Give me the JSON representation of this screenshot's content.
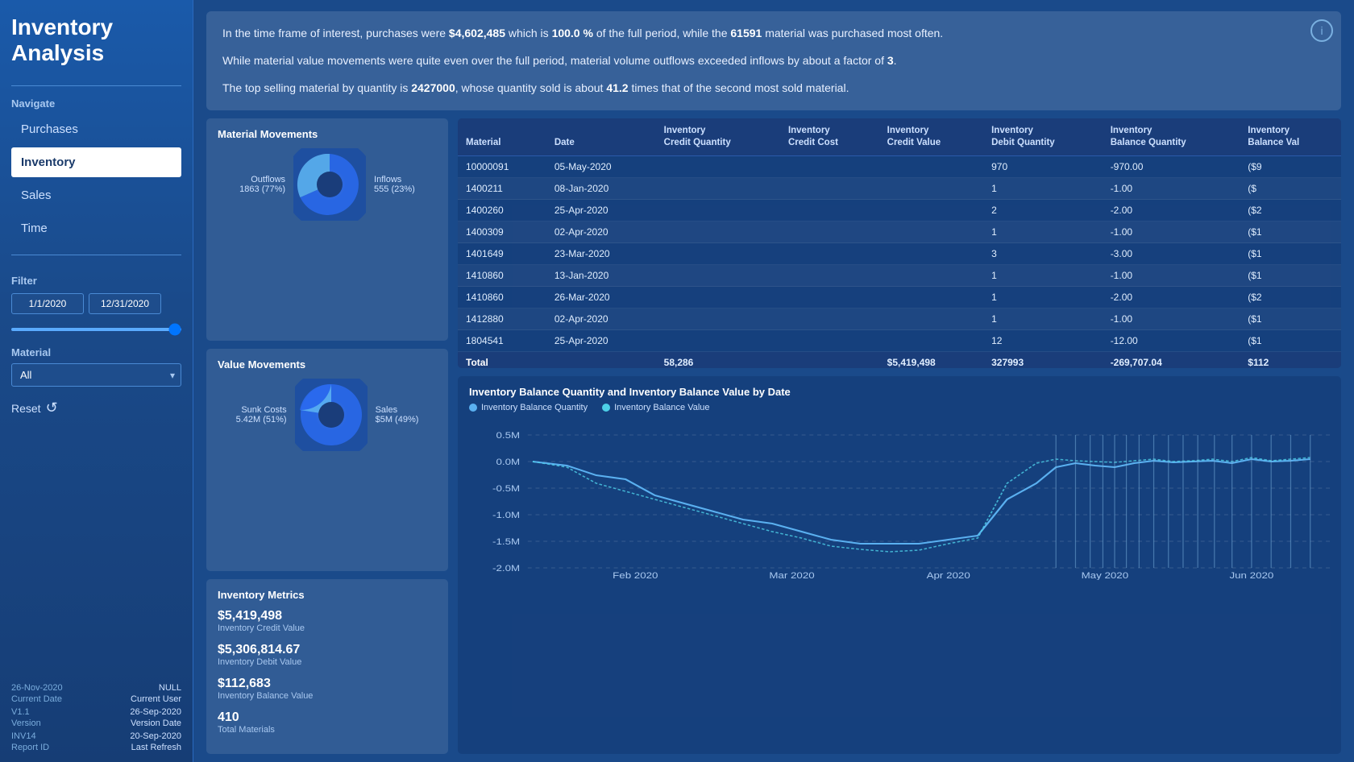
{
  "sidebar": {
    "title": "Inventory\nAnalysis",
    "navigate_label": "Navigate",
    "nav_items": [
      {
        "label": "Purchases",
        "active": false
      },
      {
        "label": "Inventory",
        "active": true
      },
      {
        "label": "Sales",
        "active": false
      },
      {
        "label": "Time",
        "active": false
      }
    ],
    "filter_label": "Filter",
    "date_start": "1/1/2020",
    "date_end": "12/31/2020",
    "material_label": "Material",
    "material_value": "All",
    "reset_label": "Reset",
    "footer": [
      {
        "key": "26-Nov-2020",
        "val": "NULL",
        "key_label": "Current Date",
        "val_label": "Current User"
      },
      {
        "key": "V1.1",
        "val": "26-Sep-2020",
        "key_label": "Version",
        "val_label": "Version Date"
      },
      {
        "key": "INV14",
        "val": "20-Sep-2020",
        "key_label": "Report ID",
        "val_label": "Last Refresh"
      }
    ]
  },
  "insight": {
    "line1_pre": "In the time frame of interest, purchases were ",
    "line1_amount": "$4,602,485",
    "line1_mid": " which is ",
    "line1_pct": "100.0 %",
    "line1_post": " of the full period, while the ",
    "line1_material": "61591",
    "line1_end": " material was purchased most often.",
    "line2": "While material value movements were quite even over the full period, material volume outflows exceeded inflows by about a factor of ",
    "line2_bold": "3",
    "line2_end": ".",
    "line3_pre": "The top selling material by quantity is ",
    "line3_material": "2427000",
    "line3_mid": ", whose quantity sold is about ",
    "line3_times": "41.2",
    "line3_end": " times that of the second most sold material."
  },
  "material_movements": {
    "title": "Material Movements",
    "outflows_label": "Outflows",
    "outflows_val": "1863 (77%)",
    "inflows_label": "Inflows",
    "inflows_val": "555 (23%)",
    "outflows_pct": 77,
    "inflows_pct": 23
  },
  "value_movements": {
    "title": "Value Movements",
    "sunk_label": "Sunk Costs",
    "sunk_val": "5.42M (51%)",
    "sales_label": "Sales",
    "sales_val": "$5M (49%)",
    "sunk_pct": 51,
    "sales_pct": 49
  },
  "metrics": {
    "title": "Inventory Metrics",
    "items": [
      {
        "value": "$5,419,498",
        "label": "Inventory Credit Value"
      },
      {
        "value": "$5,306,814.67",
        "label": "Inventory Debit Value"
      },
      {
        "value": "$112,683",
        "label": "Inventory Balance Value"
      },
      {
        "value": "410",
        "label": "Total Materials"
      }
    ]
  },
  "table": {
    "columns": [
      "Material",
      "Date",
      "Inventory\nCredit Quantity",
      "Inventory\nCredit Cost",
      "Inventory\nCredit Value",
      "Inventory\nDebit Quantity",
      "Inventory\nBalance Quantity",
      "Inventory\nBalance Val"
    ],
    "rows": [
      [
        "10000091",
        "05-May-2020",
        "",
        "",
        "",
        "970",
        "-970.00",
        "($9"
      ],
      [
        "1400211",
        "08-Jan-2020",
        "",
        "",
        "",
        "1",
        "-1.00",
        "($"
      ],
      [
        "1400260",
        "25-Apr-2020",
        "",
        "",
        "",
        "2",
        "-2.00",
        "($2"
      ],
      [
        "1400309",
        "02-Apr-2020",
        "",
        "",
        "",
        "1",
        "-1.00",
        "($1"
      ],
      [
        "1401649",
        "23-Mar-2020",
        "",
        "",
        "",
        "3",
        "-3.00",
        "($1"
      ],
      [
        "1410860",
        "13-Jan-2020",
        "",
        "",
        "",
        "1",
        "-1.00",
        "($1"
      ],
      [
        "1410860",
        "26-Mar-2020",
        "",
        "",
        "",
        "1",
        "-2.00",
        "($2"
      ],
      [
        "1412880",
        "02-Apr-2020",
        "",
        "",
        "",
        "1",
        "-1.00",
        "($1"
      ],
      [
        "1804541",
        "25-Apr-2020",
        "",
        "",
        "",
        "12",
        "-12.00",
        "($1"
      ]
    ],
    "total_row": [
      "Total",
      "",
      "58,286",
      "",
      "$5,419,498",
      "327993",
      "-269,707.04",
      "$112"
    ]
  },
  "line_chart": {
    "title": "Inventory Balance Quantity and Inventory Balance Value by Date",
    "legend": [
      {
        "label": "Inventory Balance Quantity",
        "color": "#5ab0f0"
      },
      {
        "label": "Inventory Balance Value",
        "color": "#4dd0e8"
      }
    ],
    "y_labels": [
      "0.5M",
      "0.0M",
      "-0.5M",
      "-1.0M",
      "-1.5M",
      "-2.0M"
    ],
    "x_labels": [
      "Feb 2020",
      "Mar 2020",
      "Apr 2020",
      "May 2020",
      "Jun 2020"
    ]
  },
  "info_icon_label": "i"
}
